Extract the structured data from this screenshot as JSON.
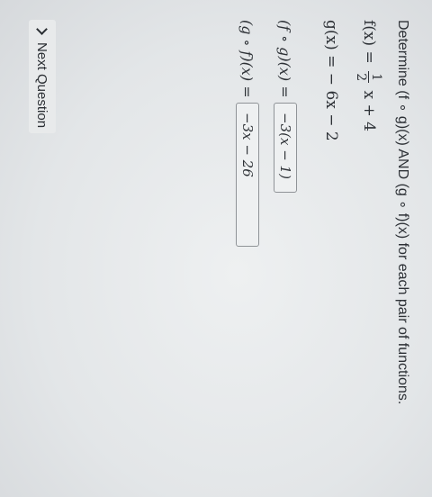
{
  "prompt": "Determine (f ∘ g)(x) AND (g ∘ f)(x) for each pair of functions.",
  "functions": {
    "f_lhs": "f(x) =",
    "f_frac_num": "1",
    "f_frac_den": "2",
    "f_rhs": "x + 4",
    "g_lhs": "g(x) =",
    "g_rhs": "− 6x − 2"
  },
  "answers": {
    "fog_label": "(f ∘ g)(x) =",
    "fog_value": "−3(x − 1)",
    "gof_label": "(g ∘ f)(x) =",
    "gof_value": "−3x − 26"
  },
  "next_button": {
    "label": "Next Question"
  }
}
